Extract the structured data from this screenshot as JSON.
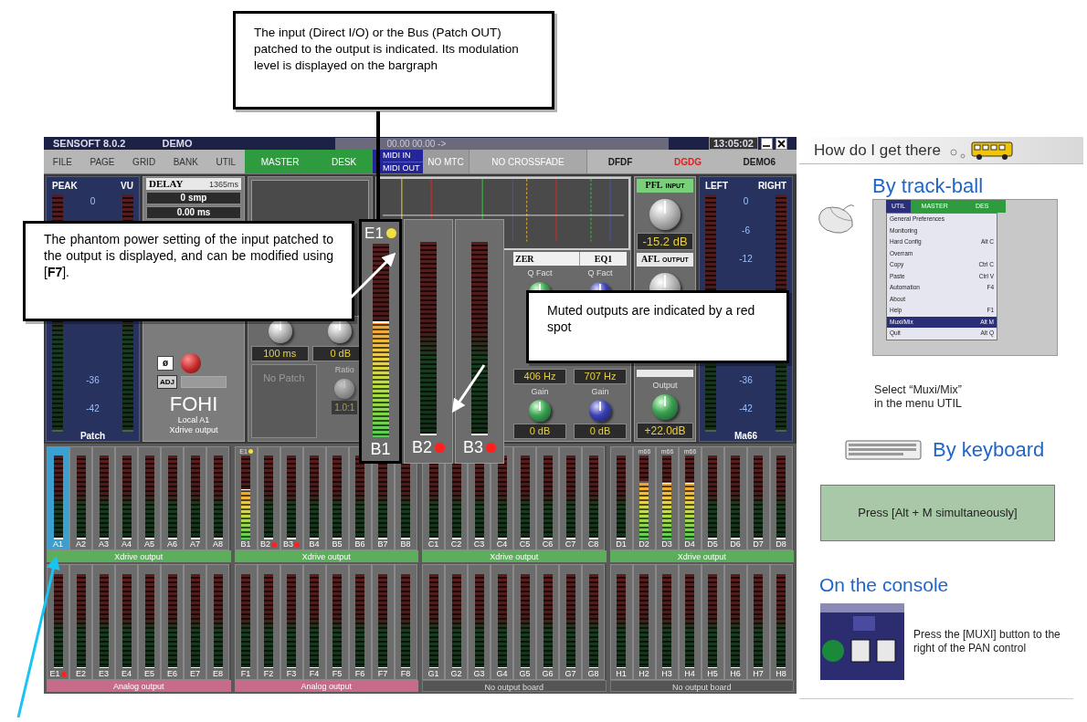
{
  "callouts": [
    {
      "text": "The input (Direct I/O) or the Bus (Patch OUT) patched to the output is indicated. Its modulation level is displayed on the bargraph"
    },
    {
      "text": "The phantom power setting of the input patched to the output is displayed, and can be modified using [**F7**]."
    },
    {
      "text": "Muted outputs are indicated by a red spot"
    }
  ],
  "console": {
    "title_bar": {
      "app": "SENSOFT 8.0.2",
      "mode": "DEMO",
      "timecode": "00.00 00.00 ->",
      "clock": "13:05:02"
    },
    "menu": [
      {
        "label": "FILE"
      },
      {
        "label": "PAGE"
      },
      {
        "label": "GRID"
      },
      {
        "label": "BANK"
      },
      {
        "label": "UTIL"
      }
    ],
    "tabs": [
      {
        "label": "MASTER"
      },
      {
        "label": "DESK"
      }
    ],
    "midi": [
      "MIDI IN",
      "MIDI OUT"
    ],
    "status": [
      "NO MTC",
      "NO CROSSFADE"
    ],
    "scenes": [
      {
        "label": "DFDF",
        "color": "#1a1a1a"
      },
      {
        "label": "DGDG",
        "color": "#e02020"
      },
      {
        "label": "DEMO6",
        "color": "#1a1a1a"
      }
    ],
    "left_meter": {
      "headers": [
        "PEAK",
        "VU"
      ],
      "scale_upper": [
        "0"
      ],
      "scale_lower": [
        "-36",
        "-42"
      ],
      "label": "Patch"
    },
    "channel": {
      "delay_title": "DELAY",
      "delay_time": "1365ms",
      "samples": "0 smp",
      "ms": "0.00 ms",
      "phase": "ø",
      "adjust": "ADJ",
      "name": "FOHI",
      "source": "Local A1",
      "output": "Xdrive output"
    },
    "dynamics": {
      "time": "100 ms",
      "gain": "0 dB",
      "ratio_label": "Ratio",
      "patch": "No Patch",
      "ratio": "1.0:1"
    },
    "eq": {
      "title": "ZER",
      "band": "EQ1",
      "bands": [
        {
          "q_label": "Q Fact",
          "freq": "406 Hz",
          "gain_label": "Gain",
          "gain": "0 dB"
        },
        {
          "q_label": "Q Fact",
          "freq": "707 Hz",
          "gain_label": "Gain",
          "gain": "0 dB"
        }
      ]
    },
    "pfl": {
      "title": "PFL",
      "sub": "INPUT",
      "reading": "-15.2 dB"
    },
    "afl": {
      "title": "AFL",
      "sub": "OUTPUT"
    },
    "output_gain": {
      "label": "Output",
      "reading": "+22.0dB"
    },
    "right_meter": {
      "headers": [
        "LEFT",
        "RIGHT"
      ],
      "scale_upper": [
        "0",
        "-6",
        "-12"
      ],
      "scale_lower": [
        "-36",
        "-42"
      ],
      "label": "Ma66"
    },
    "popup": [
      {
        "source": "E1",
        "phantom": true,
        "label": "B1",
        "muted": false,
        "level": 0.6
      },
      {
        "label": "B2",
        "phantom": false,
        "muted": true,
        "level": 0
      },
      {
        "label": "B3",
        "phantom": false,
        "muted": true,
        "level": 0
      }
    ],
    "banks": [
      {
        "strips": [
          {
            "label": "A1",
            "selected": true,
            "muted": false,
            "phantom": false,
            "level": 0
          },
          {
            "label": "A2",
            "selected": false,
            "muted": false,
            "phantom": false,
            "level": 0
          },
          {
            "label": "A3",
            "selected": false,
            "muted": false,
            "phantom": false,
            "level": 0
          },
          {
            "label": "A4",
            "selected": false,
            "muted": false,
            "phantom": false,
            "level": 0
          },
          {
            "label": "A5",
            "selected": false,
            "muted": false,
            "phantom": false,
            "level": 0
          },
          {
            "label": "A6",
            "selected": false,
            "muted": false,
            "phantom": false,
            "level": 0
          },
          {
            "label": "A7",
            "selected": false,
            "muted": false,
            "phantom": false,
            "level": 0
          },
          {
            "label": "A8",
            "selected": false,
            "muted": false,
            "phantom": false,
            "level": 0
          }
        ],
        "output": {
          "label": "Xdrive output",
          "kind": "xdrive"
        }
      },
      {
        "strips": [
          {
            "label": "B1",
            "source": "E1",
            "selected": false,
            "muted": false,
            "phantom": true,
            "level": 0.6
          },
          {
            "label": "B2",
            "selected": false,
            "muted": true,
            "phantom": false,
            "level": 0
          },
          {
            "label": "B3",
            "selected": false,
            "muted": true,
            "phantom": false,
            "level": 0
          },
          {
            "label": "B4",
            "selected": false,
            "muted": false,
            "phantom": false,
            "level": 0
          },
          {
            "label": "B5",
            "selected": false,
            "muted": false,
            "phantom": false,
            "level": 0
          },
          {
            "label": "B6",
            "selected": false,
            "muted": false,
            "phantom": false,
            "level": 0
          },
          {
            "label": "B7",
            "selected": false,
            "muted": false,
            "phantom": false,
            "level": 0
          },
          {
            "label": "B8",
            "selected": false,
            "muted": false,
            "phantom": false,
            "level": 0
          }
        ],
        "output": {
          "label": "Xdrive output",
          "kind": "xdrive"
        }
      },
      {
        "strips": [
          {
            "label": "C1",
            "selected": false,
            "muted": false,
            "phantom": false,
            "level": 0
          },
          {
            "label": "C2",
            "selected": false,
            "muted": false,
            "phantom": false,
            "level": 0
          },
          {
            "label": "C3",
            "selected": false,
            "muted": false,
            "phantom": false,
            "level": 0
          },
          {
            "label": "C4",
            "selected": false,
            "muted": false,
            "phantom": false,
            "level": 0
          },
          {
            "label": "C5",
            "selected": false,
            "muted": false,
            "phantom": false,
            "level": 0
          },
          {
            "label": "C6",
            "selected": false,
            "muted": false,
            "phantom": false,
            "level": 0
          },
          {
            "label": "C7",
            "selected": false,
            "muted": false,
            "phantom": false,
            "level": 0
          },
          {
            "label": "C8",
            "selected": false,
            "muted": false,
            "phantom": false,
            "level": 0
          }
        ],
        "output": {
          "label": "Xdrive output",
          "kind": "xdrive"
        }
      },
      {
        "strips": [
          {
            "label": "D1",
            "selected": false,
            "muted": false,
            "phantom": false,
            "level": 0
          },
          {
            "label": "D2",
            "source": "m66",
            "selected": false,
            "muted": false,
            "phantom": false,
            "level": 0.7
          },
          {
            "label": "D3",
            "source": "m66",
            "selected": false,
            "muted": false,
            "phantom": false,
            "level": 0.68
          },
          {
            "label": "D4",
            "source": "m66",
            "selected": false,
            "muted": false,
            "phantom": false,
            "level": 0.68
          },
          {
            "label": "D5",
            "selected": false,
            "muted": false,
            "phantom": false,
            "level": 0
          },
          {
            "label": "D6",
            "selected": false,
            "muted": false,
            "phantom": false,
            "level": 0
          },
          {
            "label": "D7",
            "selected": false,
            "muted": false,
            "phantom": false,
            "level": 0
          },
          {
            "label": "D8",
            "selected": false,
            "muted": false,
            "phantom": false,
            "level": 0
          }
        ],
        "output": {
          "label": "Xdrive output",
          "kind": "xdrive"
        }
      },
      {
        "strips": [
          {
            "label": "E1",
            "selected": false,
            "muted": true,
            "phantom": false,
            "level": 0
          },
          {
            "label": "E2",
            "selected": false,
            "muted": false,
            "phantom": false,
            "level": 0
          },
          {
            "label": "E3",
            "selected": false,
            "muted": false,
            "phantom": false,
            "level": 0
          },
          {
            "label": "E4",
            "selected": false,
            "muted": false,
            "phantom": false,
            "level": 0
          },
          {
            "label": "E5",
            "selected": false,
            "muted": false,
            "phantom": false,
            "level": 0
          },
          {
            "label": "E6",
            "selected": false,
            "muted": false,
            "phantom": false,
            "level": 0
          },
          {
            "label": "E7",
            "selected": false,
            "muted": false,
            "phantom": false,
            "level": 0
          },
          {
            "label": "E8",
            "selected": false,
            "muted": false,
            "phantom": false,
            "level": 0
          }
        ],
        "output": {
          "label": "Analog output",
          "kind": "analog"
        }
      },
      {
        "strips": [
          {
            "label": "F1",
            "selected": false,
            "muted": false,
            "phantom": false,
            "level": 0
          },
          {
            "label": "F2",
            "selected": false,
            "muted": false,
            "phantom": false,
            "level": 0
          },
          {
            "label": "F3",
            "selected": false,
            "muted": false,
            "phantom": false,
            "level": 0
          },
          {
            "label": "F4",
            "selected": false,
            "muted": false,
            "phantom": false,
            "level": 0
          },
          {
            "label": "F5",
            "selected": false,
            "muted": false,
            "phantom": false,
            "level": 0
          },
          {
            "label": "F6",
            "selected": false,
            "muted": false,
            "phantom": false,
            "level": 0
          },
          {
            "label": "F7",
            "selected": false,
            "muted": false,
            "phantom": false,
            "level": 0
          },
          {
            "label": "F8",
            "selected": false,
            "muted": false,
            "phantom": false,
            "level": 0
          }
        ],
        "output": {
          "label": "Analog output",
          "kind": "analog"
        }
      },
      {
        "strips": [
          {
            "label": "G1",
            "selected": false,
            "muted": false,
            "phantom": false,
            "level": 0
          },
          {
            "label": "G2",
            "selected": false,
            "muted": false,
            "phantom": false,
            "level": 0
          },
          {
            "label": "G3",
            "selected": false,
            "muted": false,
            "phantom": false,
            "level": 0
          },
          {
            "label": "G4",
            "selected": false,
            "muted": false,
            "phantom": false,
            "level": 0
          },
          {
            "label": "G5",
            "selected": false,
            "muted": false,
            "phantom": false,
            "level": 0
          },
          {
            "label": "G6",
            "selected": false,
            "muted": false,
            "phantom": false,
            "level": 0
          },
          {
            "label": "G7",
            "selected": false,
            "muted": false,
            "phantom": false,
            "level": 0
          },
          {
            "label": "G8",
            "selected": false,
            "muted": false,
            "phantom": false,
            "level": 0
          }
        ],
        "output": {
          "label": "No output board",
          "kind": "none"
        }
      },
      {
        "strips": [
          {
            "label": "H1",
            "selected": false,
            "muted": false,
            "phantom": false,
            "level": 0
          },
          {
            "label": "H2",
            "selected": false,
            "muted": false,
            "phantom": false,
            "level": 0
          },
          {
            "label": "H3",
            "selected": false,
            "muted": false,
            "phantom": false,
            "level": 0
          },
          {
            "label": "H4",
            "selected": false,
            "muted": false,
            "phantom": false,
            "level": 0
          },
          {
            "label": "H5",
            "selected": false,
            "muted": false,
            "phantom": false,
            "level": 0
          },
          {
            "label": "H6",
            "selected": false,
            "muted": false,
            "phantom": false,
            "level": 0
          },
          {
            "label": "H7",
            "selected": false,
            "muted": false,
            "phantom": false,
            "level": 0
          },
          {
            "label": "H8",
            "selected": false,
            "muted": false,
            "phantom": false,
            "level": 0
          }
        ],
        "output": {
          "label": "No output board",
          "kind": "none"
        }
      }
    ]
  },
  "help": {
    "title": "How do I get there",
    "sections": [
      {
        "kind": "trackball",
        "heading": "By track-ball",
        "menubar": [
          {
            "label": "UTIL",
            "selected": true
          },
          {
            "label": "MASTER",
            "selected": false
          },
          {
            "label": "DES",
            "selected": false
          }
        ],
        "items": [
          {
            "label": "General Preferences",
            "selected": false
          },
          {
            "label": "Monitoring",
            "selected": false
          },
          {
            "label": "Hard Config",
            "shortcut": "Alt C",
            "selected": false
          },
          {
            "label": "Overram",
            "selected": false
          },
          {
            "label": "Copy",
            "shortcut": "Ctrl C",
            "selected": false
          },
          {
            "label": "Paste",
            "shortcut": "Ctrl V",
            "selected": false
          },
          {
            "label": "Automation",
            "shortcut": "F4",
            "selected": false
          },
          {
            "label": "About",
            "selected": false
          },
          {
            "label": "Help",
            "shortcut": "F1",
            "selected": false
          },
          {
            "label": "Muxi/Mix",
            "shortcut": "Alt M",
            "selected": true
          },
          {
            "label": "Quit",
            "shortcut": "Alt Q",
            "selected": false
          }
        ],
        "caption": "Select “Muxi/Mix”\nin the menu UTIL"
      },
      {
        "kind": "keyboard",
        "heading": "By keyboard",
        "note": "Press [Alt + M simultaneously]"
      },
      {
        "kind": "console",
        "heading": "On the console",
        "caption": "Press the [MUXI] button to the right of the PAN control"
      }
    ]
  }
}
